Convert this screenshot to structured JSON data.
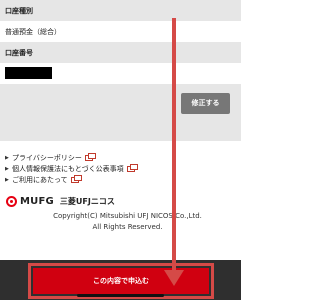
{
  "form": {
    "account_type_label": "口座種別",
    "account_type_value": "普通預金（総合）",
    "account_number_label": "口座番号"
  },
  "edit": {
    "button_label": "修正する"
  },
  "links": [
    {
      "label": "プライバシーポリシー"
    },
    {
      "label": "個人情報保護法にもとづく公表事項"
    },
    {
      "label": "ご利用にあたって"
    }
  ],
  "brand": {
    "logo_text": "MUFG",
    "company_name": "三菱UFJニコス"
  },
  "copyright": {
    "line1": "Copyright(C) Mitsubishi UFJ NICOS Co.,Ltd.",
    "line2": "All Rights Reserved."
  },
  "submit": {
    "label": "この内容で申込む"
  },
  "colors": {
    "accent": "#d00010",
    "annotation": "#d54a47",
    "bottom_bar": "#2f2f2f"
  }
}
